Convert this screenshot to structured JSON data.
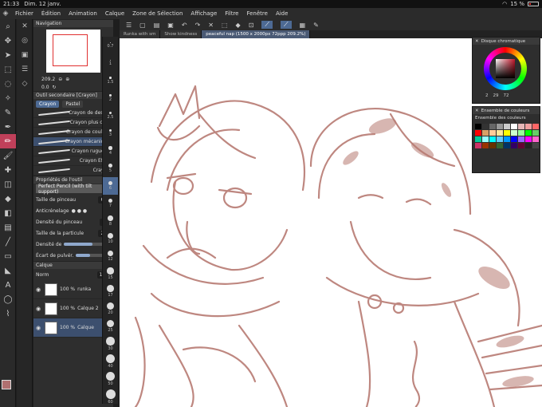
{
  "status": {
    "time": "21:33",
    "date": "Dim. 12 janv.",
    "battery": "15 %"
  },
  "menu": [
    "Fichier",
    "Édition",
    "Animation",
    "Calque",
    "Zone de Sélection",
    "Affichage",
    "Filtre",
    "Fenêtre",
    "Aide"
  ],
  "doc_tabs": [
    "Runka with sm",
    "Show kindness",
    "peaceful nap (1500 x 2000px 72ppp 209.2%)"
  ],
  "navigation": {
    "title": "Navigation",
    "zoom": "209.2",
    "rotation": "0.0"
  },
  "subtool": {
    "title": "Outil secondaire [Crayon]",
    "tabs": [
      "Crayon",
      "Pastel"
    ],
    "brushes": [
      "Crayon de dessin",
      "Crayon plus clair",
      "Crayon de couleur",
      "Crayon mécanique",
      "Crayon rugueux",
      "Crayon Effilé",
      "Crayon"
    ]
  },
  "properties": {
    "title": "Propriétés de l'outil",
    "preset": "Perfect Pencil (with tilt support)",
    "brush_size_label": "Taille de pinceau",
    "brush_size": "6.0",
    "antialias_label": "Anticrénelage",
    "density_label": "Densité du pinceau",
    "density": "54",
    "particle_label": "Taille de la particule",
    "particle": "2.5",
    "density2_label": "Densité de",
    "spacing_label": "Écart de pulvér."
  },
  "layers": {
    "title": "Calque",
    "blend": "Norm",
    "opacity": "100",
    "items": [
      {
        "opacity": "100 %",
        "name": "runka"
      },
      {
        "opacity": "100 %",
        "name": "Calque 2"
      },
      {
        "opacity": "100 %",
        "name": "Calque"
      }
    ]
  },
  "brush_sizes": [
    "0.7",
    "1",
    "1.5",
    "2",
    "2.5",
    "3",
    "4",
    "5",
    "6",
    "7",
    "8",
    "10",
    "12",
    "15",
    "17",
    "20",
    "25",
    "30",
    "40",
    "50",
    "60"
  ],
  "color_wheel": {
    "title": "Disque chromatique",
    "h": "2",
    "s": "29",
    "v": "72"
  },
  "color_set": {
    "title": "Ensemble de couleurs",
    "name": "Ensemble des couleurs",
    "colors": [
      "#000000",
      "#333333",
      "#666666",
      "#999999",
      "#cccccc",
      "#ffffff",
      "#e6b8b8",
      "#f0a0a0",
      "#ff6666",
      "#ff0000",
      "#d9a066",
      "#ffcc99",
      "#ffe699",
      "#ffff00",
      "#ccffcc",
      "#99ff99",
      "#00ff00",
      "#66cc66",
      "#00cc99",
      "#99ffff",
      "#00ffff",
      "#66ccff",
      "#0099ff",
      "#0000ff",
      "#9966ff",
      "#ff00ff",
      "#ff66cc",
      "#cc3366",
      "#993300",
      "#663300",
      "#336633",
      "#003366",
      "#330066",
      "#660033",
      "#222222",
      "#444444"
    ]
  }
}
